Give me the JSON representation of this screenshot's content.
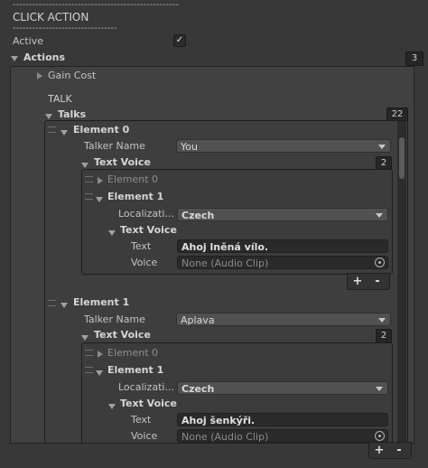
{
  "header": {
    "dash_top": "---------------------------------------------------",
    "title": "CLICK ACTION",
    "dash_bottom": "--------------------------------"
  },
  "active": {
    "label": "Active",
    "checked": true,
    "check_glyph": "✓"
  },
  "actions": {
    "label": "Actions",
    "count": "3",
    "gain_cost": "Gain Cost",
    "talk_header": "TALK",
    "talks_label": "Talks",
    "talks_count": "22",
    "elements": [
      {
        "label": "Element 0",
        "talker_name_label": "Talker Name",
        "talker_name_value": "You",
        "text_voice_label": "Text Voice",
        "text_voice_count": "2",
        "sub_element0": "Element 0",
        "sub_element1": "Element 1",
        "localization_label": "Localizati...",
        "localization_value": "Czech",
        "inner_text_voice": "Text Voice",
        "text_label": "Text",
        "text_value": "Ahoj lněná vílo.",
        "voice_label": "Voice",
        "voice_value": "None (Audio Clip)"
      },
      {
        "label": "Element 1",
        "talker_name_label": "Talker Name",
        "talker_name_value": "Aplava",
        "text_voice_label": "Text Voice",
        "text_voice_count": "2",
        "sub_element0": "Element 0",
        "sub_element1": "Element 1",
        "localization_label": "Localizati...",
        "localization_value": "Czech",
        "inner_text_voice": "Text Voice",
        "text_label": "Text",
        "text_value": "Ahoj šenkýři.",
        "voice_label": "Voice",
        "voice_value": "None (Audio Clip)"
      }
    ],
    "plus": "+",
    "minus": "-"
  }
}
